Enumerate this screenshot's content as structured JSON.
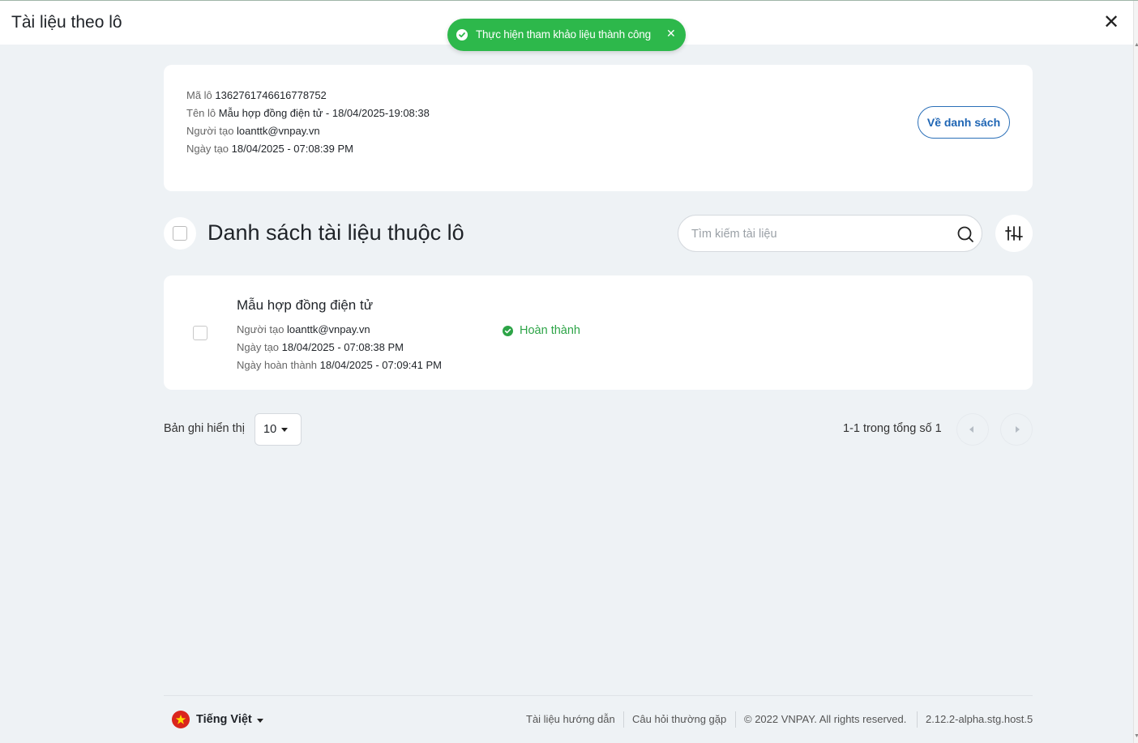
{
  "header": {
    "title": "Tài liệu theo lô"
  },
  "toast": {
    "message": "Thực hiện tham khảo liệu thành công"
  },
  "batch": {
    "code_label": "Mã lô",
    "code_value": "1362761746616778752",
    "name_label": "Tên lô",
    "name_value": "Mẫu hợp đồng điện tử - 18/04/2025-19:08:38",
    "creator_label": "Người tạo",
    "creator_value": "loanttk@vnpay.vn",
    "created_label": "Ngày tạo",
    "created_value": "18/04/2025 - 07:08:39 PM",
    "back_button": "Về danh sách"
  },
  "list": {
    "title": "Danh sách tài liệu thuộc lô",
    "search_placeholder": "Tìm kiếm tài liệu"
  },
  "documents": [
    {
      "title": "Mẫu hợp đồng điện tử",
      "creator_label": "Người tạo",
      "creator_value": "loanttk@vnpay.vn",
      "created_label": "Ngày tạo",
      "created_value": "18/04/2025 - 07:08:38 PM",
      "completed_label": "Ngày hoàn thành",
      "completed_value": "18/04/2025 - 07:09:41 PM",
      "status": "Hoàn thành"
    }
  ],
  "pagination": {
    "page_size_label": "Bản ghi hiển thị",
    "page_size": "10",
    "range_text": "1-1 trong tổng số 1"
  },
  "footer": {
    "language": "Tiếng Việt",
    "guide_link": "Tài liệu hướng dẫn",
    "faq_link": "Câu hỏi thường gặp",
    "copyright": "© 2022 VNPAY. All rights reserved.",
    "version": "2.12.2-alpha.stg.host.5"
  },
  "colors": {
    "success": "#2db84b",
    "primary": "#1e65b4",
    "background": "#eef2f5"
  }
}
